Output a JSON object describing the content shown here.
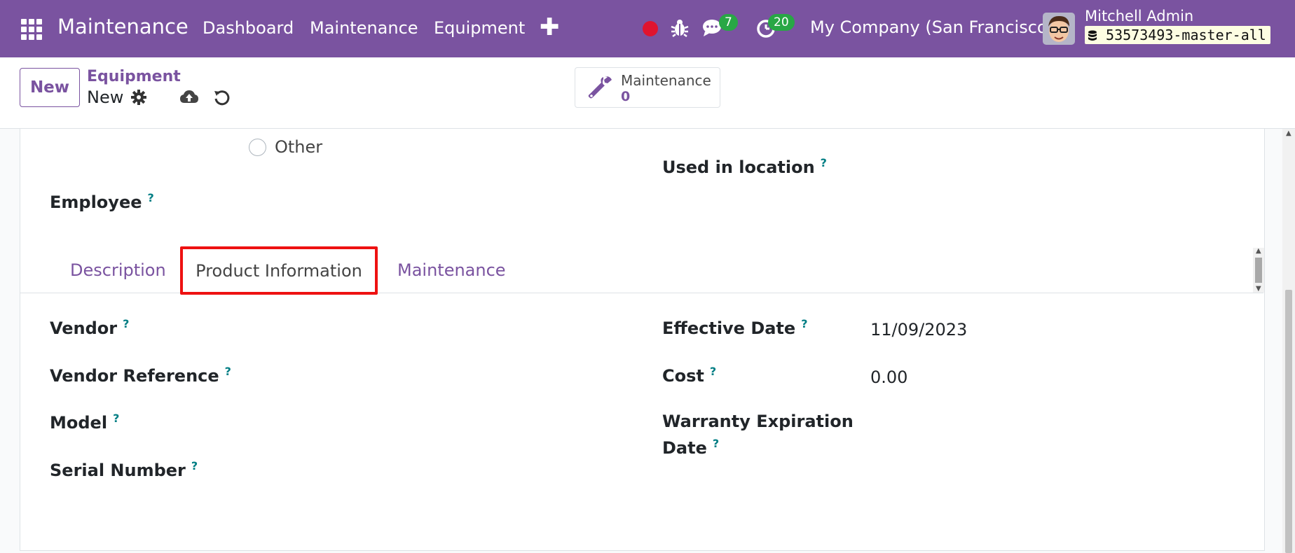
{
  "navbar": {
    "brand": "Maintenance",
    "menu": [
      "Dashboard",
      "Maintenance",
      "Equipment"
    ],
    "plus": "✚",
    "messages_count": "7",
    "activities_count": "20",
    "company": "My Company (San Francisco)",
    "user_name": "Mitchell Admin",
    "database": "53573493-master-all",
    "icons": [
      "apps-grid-icon",
      "record-dot-icon",
      "bug-icon",
      "chat-icon",
      "clock-icon",
      "database-icon"
    ],
    "colors": {
      "brand": "#7a53a0",
      "badge": "#28a745",
      "record": "#e0142f"
    }
  },
  "control": {
    "new_button": "New",
    "breadcrumb_parent": "Equipment",
    "breadcrumb_current": "New",
    "smart_button": {
      "label": "Maintenance",
      "count": "0"
    }
  },
  "form": {
    "radio_other": "Other",
    "used_in_location": "Used in location",
    "employee": "Employee",
    "help_mark": "?",
    "tabs": [
      "Description",
      "Product Information",
      "Maintenance"
    ],
    "active_tab": "Product Information",
    "left_fields": [
      "Vendor",
      "Vendor Reference",
      "Model",
      "Serial Number"
    ],
    "right_fields": {
      "effective_date_label": "Effective Date",
      "effective_date_value": "11/09/2023",
      "cost_label": "Cost",
      "cost_value": "0.00",
      "warranty_label_line1": "Warranty Expiration",
      "warranty_label_line2": "Date"
    }
  }
}
